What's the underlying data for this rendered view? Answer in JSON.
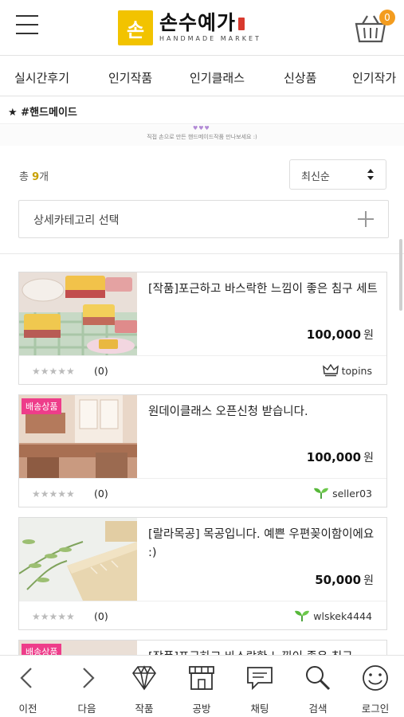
{
  "header": {
    "logo_mark": "손",
    "logo_title": "손수예가",
    "logo_sub": "HANDMADE MARKET",
    "cart_count": "0",
    "accent_color": "#f2c300",
    "cart_badge_color": "#f39c1f"
  },
  "category_nav": {
    "tabs": [
      {
        "label": "실시간후기"
      },
      {
        "label": "인기작품"
      },
      {
        "label": "인기클래스"
      },
      {
        "label": "신상품"
      },
      {
        "label": "인기작가"
      }
    ]
  },
  "hashtag": {
    "label": "★ #핸드메이드"
  },
  "banner": {
    "hearts": "♥♥♥",
    "text": "직접 손으로 만든 핸드메이드작품 만나보세요 :)"
  },
  "list": {
    "count_prefix": "총 ",
    "count_value": "9",
    "count_suffix": "개",
    "sort_label": "최신순",
    "subcategory_label": "상세카테고리 선택"
  },
  "products": [
    {
      "title": "[작품]포근하고 바스락한 느낌이 좋은 침구 세트",
      "price": "100,000",
      "currency": "원",
      "stars": "★★★★★",
      "rating": "(0)",
      "seller": "topins",
      "seller_icon": "crown-icon",
      "badge": ""
    },
    {
      "title": "원데이클래스 오픈신청 받습니다.",
      "price": "100,000",
      "currency": "원",
      "stars": "★★★★★",
      "rating": "(0)",
      "seller": "seller03",
      "seller_icon": "sprout-icon",
      "badge": "배송상품"
    },
    {
      "title": "[랄라목공] 목공입니다. 예쁜 우편꽂이함이에요 :)",
      "price": "50,000",
      "currency": "원",
      "stars": "★★★★★",
      "rating": "(0)",
      "seller": "wlskek4444",
      "seller_icon": "sprout-icon",
      "badge": ""
    },
    {
      "title": "[작품]포근하고 바스락한 느낌이 좋은 침구",
      "badge": "배송상품"
    }
  ],
  "bottom_nav": {
    "items": [
      {
        "label": "이전",
        "icon": "chevron-left-icon"
      },
      {
        "label": "다음",
        "icon": "chevron-right-icon"
      },
      {
        "label": "작품",
        "icon": "diamond-icon"
      },
      {
        "label": "공방",
        "icon": "storefront-icon"
      },
      {
        "label": "채팅",
        "icon": "chat-icon"
      },
      {
        "label": "검색",
        "icon": "search-icon"
      },
      {
        "label": "로그인",
        "icon": "smile-icon"
      }
    ]
  }
}
